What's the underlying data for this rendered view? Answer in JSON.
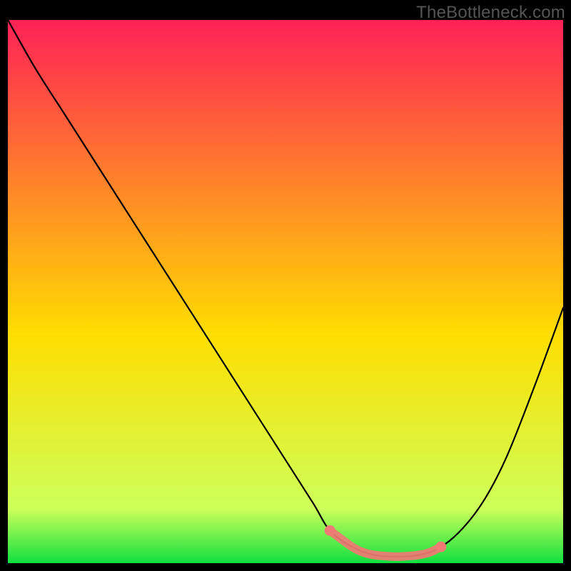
{
  "watermark": "TheBottleneck.com",
  "chart_data": {
    "type": "line",
    "title": "",
    "xlabel": "",
    "ylabel": "",
    "xlim": [
      0,
      100
    ],
    "ylim": [
      0,
      100
    ],
    "background": {
      "gradient_stops": [
        {
          "offset": 0,
          "color": "#ff2157"
        },
        {
          "offset": 0.58,
          "color": "#ffde00"
        },
        {
          "offset": 0.9,
          "color": "#cdff5a"
        },
        {
          "offset": 1.0,
          "color": "#10e040"
        }
      ]
    },
    "series": [
      {
        "name": "bottleneck-curve",
        "color": "#000000",
        "x": [
          0,
          5,
          10,
          15,
          20,
          25,
          30,
          35,
          40,
          45,
          50,
          55,
          58,
          62,
          66,
          70,
          74,
          78,
          82,
          86,
          90,
          95,
          100
        ],
        "values": [
          100,
          91,
          83,
          75,
          67,
          59,
          51,
          43,
          35,
          27,
          19,
          11,
          6,
          3,
          1.5,
          1.2,
          1.5,
          3,
          6.5,
          12,
          20,
          33,
          47
        ]
      }
    ],
    "markers": {
      "name": "highlight-band",
      "color": "#f07a74",
      "x": [
        58,
        62,
        64,
        66,
        68,
        70,
        72,
        74,
        76,
        78
      ],
      "values": [
        6,
        3,
        2,
        1.5,
        1.3,
        1.2,
        1.3,
        1.5,
        2,
        3
      ]
    }
  }
}
